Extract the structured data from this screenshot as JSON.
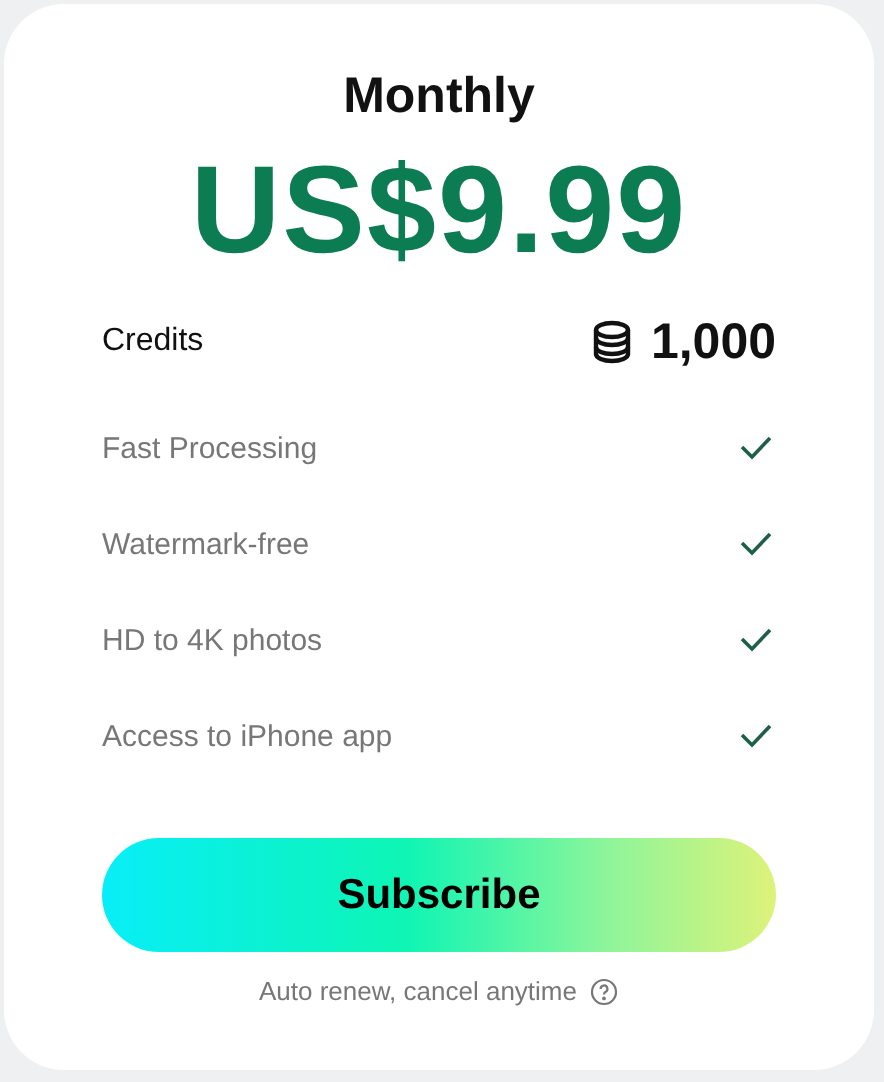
{
  "plan": {
    "title": "Monthly",
    "price": "US$9.99"
  },
  "credits": {
    "label": "Credits",
    "amount": "1,000"
  },
  "features": [
    {
      "label": "Fast Processing",
      "included": true
    },
    {
      "label": "Watermark-free",
      "included": true
    },
    {
      "label": "HD to 4K photos",
      "included": true
    },
    {
      "label": "Access to iPhone app",
      "included": true
    }
  ],
  "subscribe_button": "Subscribe",
  "note": "Auto renew, cancel anytime"
}
